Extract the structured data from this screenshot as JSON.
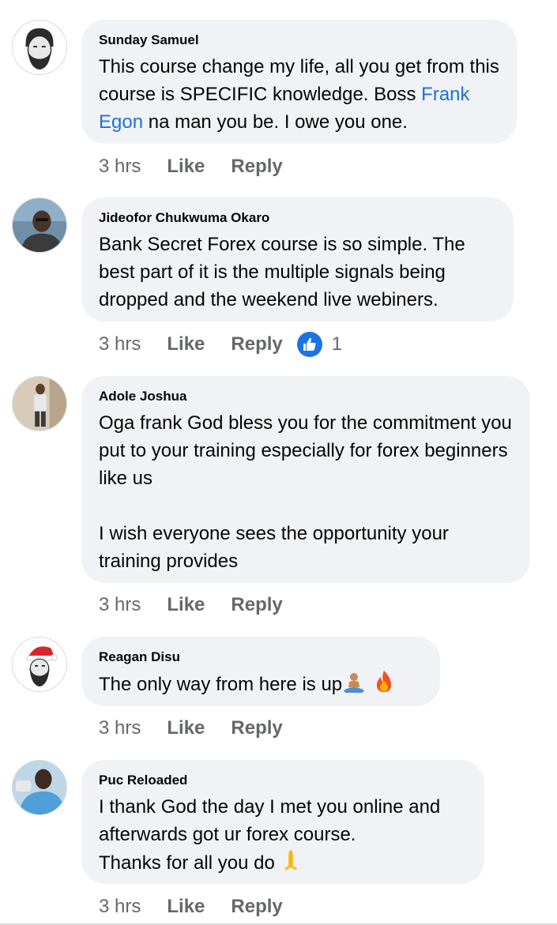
{
  "comments": [
    {
      "author": "Sunday Samuel",
      "text_before_mention": "This course change my life, all you get from this course is SPECIFIC knowledge. Boss ",
      "mention": "Frank Egon",
      "text_after_mention": " na man you be. I owe you one.",
      "time": "3 hrs",
      "like": "Like",
      "reply": "Reply",
      "avatar_icon": "bearded-man-avatar-icon"
    },
    {
      "author": "Jideofor Chukwuma Okaro",
      "text": "Bank Secret Forex course is so simple. The best part of it is the multiple signals being dropped and the weekend live webiners.",
      "time": "3 hrs",
      "like": "Like",
      "reply": "Reply",
      "reaction_count": "1",
      "reaction_icon": "like-thumb-icon",
      "reaction_color": "#1b74e4"
    },
    {
      "author": "Adole Joshua",
      "text_para1": "Oga frank God bless you for the commitment you put to your training especially for forex beginners like us",
      "text_para2": "I wish everyone sees the opportunity your training provides",
      "time": "3 hrs",
      "like": "Like",
      "reply": "Reply"
    },
    {
      "author": "Reagan Disu",
      "text": "The only way from here is up",
      "emojis": [
        "person-meditating-emoji",
        "fire-emoji"
      ],
      "time": "3 hrs",
      "like": "Like",
      "reply": "Reply",
      "avatar_icon": "santa-hat-bearded-avatar-icon"
    },
    {
      "author": "Puc Reloaded",
      "text_line1": "I thank God the day I met you online and afterwards got ur forex course.",
      "text_line2": "Thanks for all you do",
      "emojis": [
        "folded-hands-emoji"
      ],
      "time": "3 hrs",
      "like": "Like",
      "reply": "Reply"
    }
  ],
  "colors": {
    "bubble": "#f0f2f5",
    "mention": "#216fdb",
    "meta": "#65676b"
  }
}
